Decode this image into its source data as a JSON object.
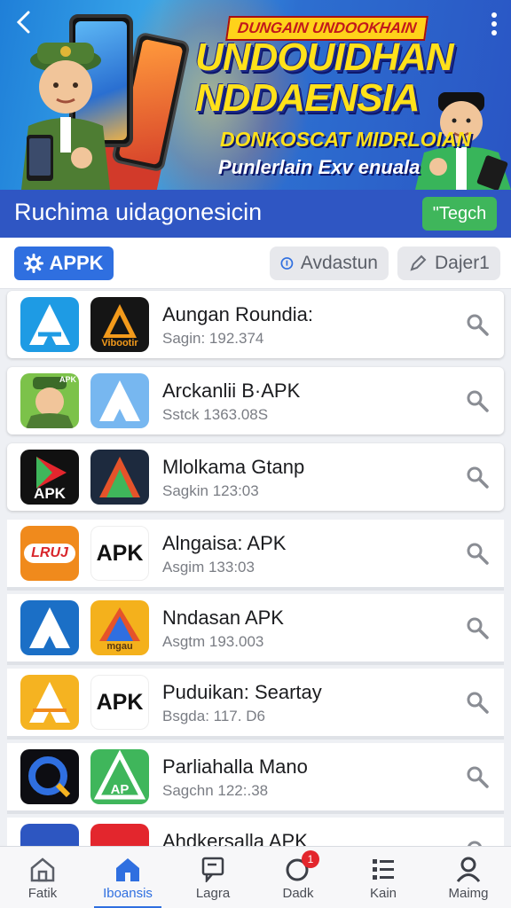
{
  "banner": {
    "top_label": "DUNGAIN UNDOOKHAIN",
    "title_line1": "UNDOUIDHAN",
    "title_line2": "NDDAENSIA",
    "subtitle1": "DONKOSCAT MIDRLOIAN",
    "subtitle2": "Punlerlain Exv enuala"
  },
  "header": {
    "title": "Ruchima uidagonesicin",
    "tag_button": "\"Tegch"
  },
  "filters": {
    "apk": "APPK",
    "chip1": "Avdastun",
    "chip2": "Dajer1"
  },
  "apps": [
    {
      "name": "Aungan Roundia:",
      "sub": "Sagin: 192.374",
      "icon_b_text": "Vibootir"
    },
    {
      "name": "Arckanlii B·APK",
      "sub": "Sstck 1363.08S",
      "icon_a_text": "APK"
    },
    {
      "name": "Mlolkama Gtanp",
      "sub": "Sagkin 123:03",
      "icon_a_text": "APK"
    },
    {
      "name": "Alngaisa: APK",
      "sub": "Asgim 133:03",
      "icon_a_text": "LRUJ",
      "icon_b_text": "APK"
    },
    {
      "name": "Nndasan APK",
      "sub": "Asgtm 193.003",
      "icon_b_text": "mgau"
    },
    {
      "name": "Puduikan: Seartay",
      "sub": "Bsgda: 117. D6",
      "icon_b_text": "APK"
    },
    {
      "name": "Parliahalla Mano",
      "sub": "Sagchn 122:.38",
      "icon_b_text": "AP"
    },
    {
      "name": "Ahdkersalla APK",
      "sub": ""
    }
  ],
  "nav": [
    {
      "label": "Fatik",
      "icon": "home-outline-icon"
    },
    {
      "label": "Iboansis",
      "icon": "home-filled-icon"
    },
    {
      "label": "Lagra",
      "icon": "message-icon"
    },
    {
      "label": "Dadk",
      "icon": "chat-icon",
      "badge": "1"
    },
    {
      "label": "Kain",
      "icon": "list-icon"
    },
    {
      "label": "Maimg",
      "icon": "person-icon"
    }
  ],
  "colors": {
    "primary": "#2f56c3",
    "accent": "#2f6fe0",
    "tag": "#3fb65b",
    "badge": "#e3262d"
  }
}
